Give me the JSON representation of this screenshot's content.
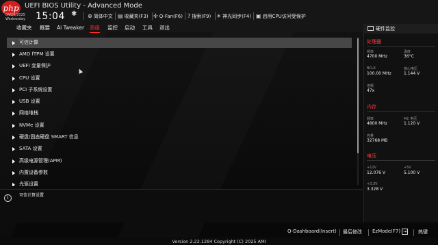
{
  "header": {
    "logo_text": "php",
    "app_title": "UEFI BIOS Utility - Advanced Mode",
    "date": "04/20/2025",
    "weekday": "Wednesday",
    "time": "15:04",
    "toolbar": [
      {
        "icon": "globe-icon",
        "label": "简体中文"
      },
      {
        "icon": "star-icon",
        "label": "收藏夹(F3)"
      },
      {
        "icon": "fan-icon",
        "label": "Q-Fan(F6)"
      },
      {
        "icon": "search-icon",
        "label": "搜索(F9)"
      },
      {
        "icon": "light-icon",
        "label": "神光同步(F4)"
      },
      {
        "icon": "cpu-icon",
        "label": "启用CPU访问受保护"
      }
    ]
  },
  "menu": {
    "items": [
      "收藏夹",
      "概要",
      "Ai Tweaker",
      "高级",
      "监控",
      "启动",
      "工具",
      "退出"
    ],
    "active_index": 3,
    "active_color": "#ff2a2a"
  },
  "main": {
    "items": [
      "可信计算",
      "AMD fTPM 设置",
      "UEFI 变量保护",
      "CPU 设置",
      "PCI 子系统设置",
      "USB 设置",
      "网络堆栈",
      "NVMe 设置",
      "硬盘/固态硬盘 SMART 信息",
      "SATA 设置",
      "高级电源管理(APM)",
      "内置设备参数",
      "光驱设置"
    ],
    "selected_index": 0
  },
  "info": {
    "icon": "info-icon",
    "text": "可信计算设置"
  },
  "monitor": {
    "title": "硬件监控",
    "accent_color": "#ff3b3b",
    "sections": {
      "cpu": {
        "title": "处理器",
        "freq_label": "频率",
        "freq_value": "4700 MHz",
        "temp_label": "温度",
        "temp_value": "36°C",
        "bclk_label": "BCLK",
        "bclk_value": "100.00 MHz",
        "core_label": "核心电压",
        "core_value": "1.144 V",
        "ratio_label": "倍频",
        "ratio_value": "47x"
      },
      "memory": {
        "title": "内存",
        "freq_label": "频率",
        "freq_value": "4800 MHz",
        "mc_label": "MC 电压",
        "mc_value": "1.120 V",
        "cap_label": "容量",
        "cap_value": "32768 MB"
      },
      "voltage": {
        "title": "电压",
        "v12_label": "+12V",
        "v12_value": "12.076 V",
        "v5_label": "+5V",
        "v5_value": "5.100 V",
        "v33_label": "+3.3V",
        "v33_value": "3.328 V"
      }
    }
  },
  "footer": {
    "qdashboard": "Q-Dashboard(Insert)",
    "last_modified": "最后修改",
    "ezmode": "EzMode(F7)",
    "hotkeys": "热键",
    "version": "Version 2.22.1284 Copyright (C) 2025 AMI"
  }
}
